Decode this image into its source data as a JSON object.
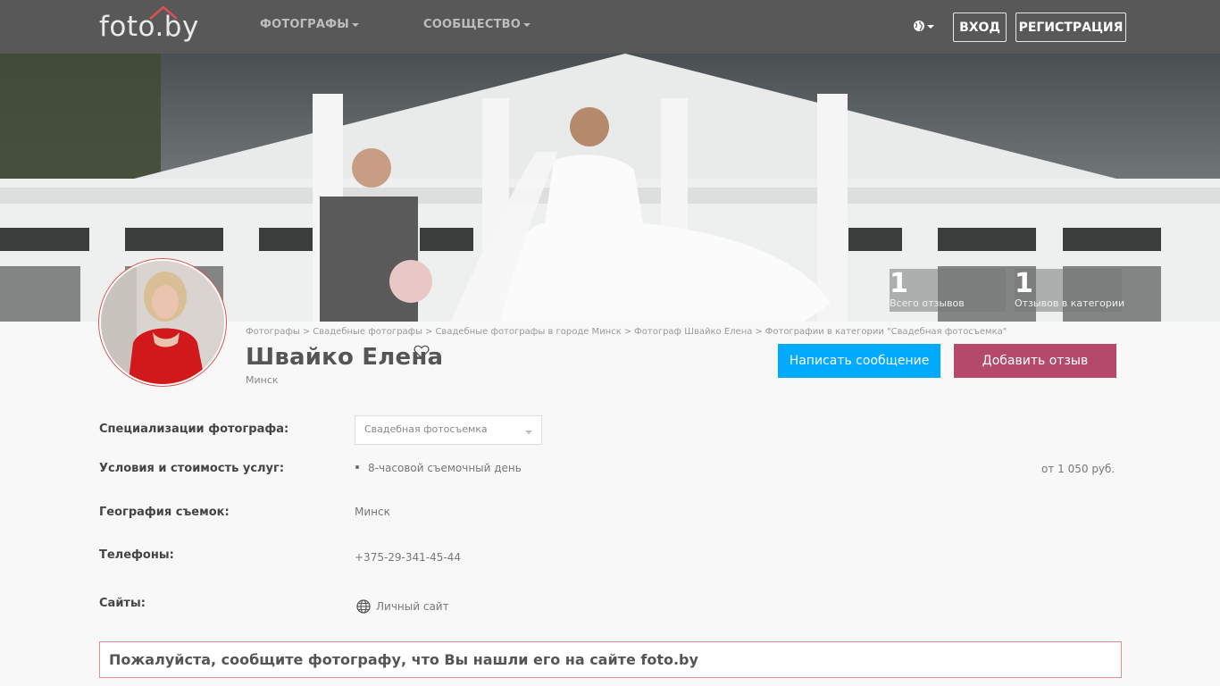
{
  "header": {
    "logo_text": "foto.by",
    "nav": [
      {
        "label": "ФОТОГРАФЫ"
      },
      {
        "label": "СООБЩЕСТВО"
      }
    ],
    "login_label": "ВХОД",
    "register_label": "РЕГИСТРАЦИЯ"
  },
  "stats": [
    {
      "value": "1",
      "label": "Всего отзывов"
    },
    {
      "value": "1",
      "label": "Отзывов в категории"
    }
  ],
  "breadcrumb": [
    "Фотографы",
    "Свадебные фотографы",
    "Свадебные фотографы в городе Минск",
    "Фотограф Швайко Елена",
    "Фотографии в категории \"Свадебная фотосъемка\""
  ],
  "breadcrumb_sep": ">",
  "profile": {
    "name": "Швайко Елена",
    "city": "Минск"
  },
  "actions": {
    "message_label": "Написать сообщение",
    "review_label": "Добавить отзыв"
  },
  "details": {
    "specializations_label": "Специализации фотографа:",
    "specialization_selected": "Свадебная фотосъемка",
    "services_label": "Условия и стоимость услуг:",
    "service_item": "8-часовой съемочный день",
    "service_price": "от 1 050 руб.",
    "geography_label": "География съемок:",
    "geography_value": "Минск",
    "phones_label": "Телефоны:",
    "phone_value": "+375-29-341-45-44",
    "sites_label": "Сайты:",
    "site_value": "Личный сайт"
  },
  "notice": "Пожалуйста, сообщите фотографу, что Вы нашли его на сайте foto.by",
  "colors": {
    "header_bg": "#585858",
    "message_button": "#00aaff",
    "review_button": "#b5496b",
    "notice_border": "#e08e8e"
  },
  "icons": [
    "globe-icon",
    "heart-icon",
    "site-globe-icon",
    "chevron-down-icon"
  ]
}
